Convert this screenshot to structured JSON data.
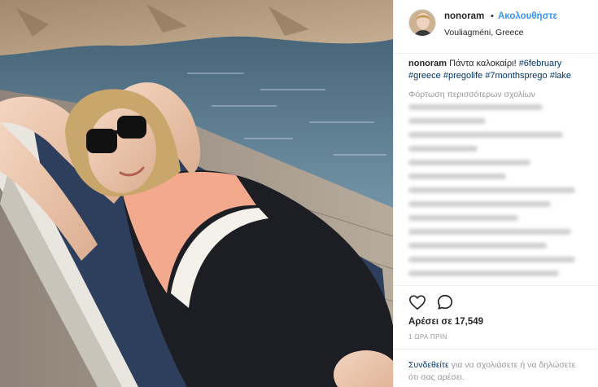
{
  "post": {
    "username": "nonoram",
    "dot": "•",
    "follow_label": "Ακολουθήστε",
    "location": "Vouliagméni, Greece",
    "caption": {
      "user": "nonoram",
      "text": " Πάντα καλοκαίρι! ",
      "hashtags": [
        "#6february",
        "#greece",
        "#pregolife",
        "#7monthsprego",
        "#lake"
      ]
    },
    "load_more_label": "Φόρτωση περισσότερων σχολίων",
    "likes_text": "Αρέσει σε 17,549",
    "time_text": "1 ΩΡΑ ΠΡΙΝ",
    "login": {
      "link_label": "Συνδεθείτε",
      "rest_text": " για να σχολιάσετε ή να δηλώσετε ότι σας αρέσει."
    }
  },
  "icons": {
    "heart": "heart-outline-icon",
    "comment": "comment-bubble-icon"
  },
  "colors": {
    "link_blue": "#3897f0",
    "hashtag_navy": "#003569",
    "muted_gray": "#999999",
    "text": "#262626"
  }
}
